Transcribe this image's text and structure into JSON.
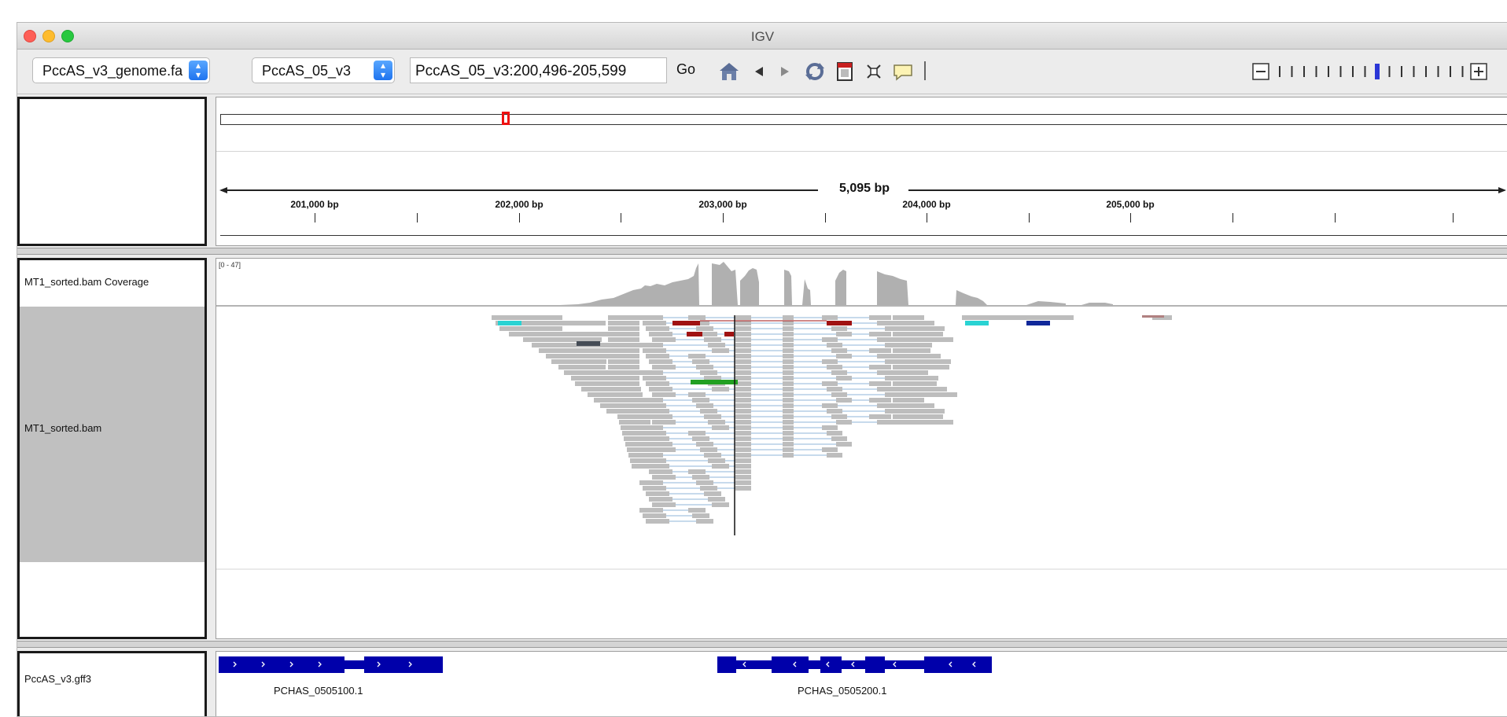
{
  "window": {
    "title": "IGV"
  },
  "toolbar": {
    "genome": "PccAS_v3_genome.fa",
    "chromosome": "PccAS_05_v3",
    "locus": "PccAS_05_v3:200,496-205,599",
    "go_label": "Go",
    "icons": [
      "home-icon",
      "back-arrow-icon",
      "forward-arrow-icon",
      "refresh-icon",
      "region-of-interest-icon",
      "resize-to-window-icon",
      "popup-text-icon"
    ]
  },
  "ruler": {
    "span_label": "5,095 bp",
    "ticks": [
      "201,000 bp",
      "202,000 bp",
      "203,000 bp",
      "204,000 bp",
      "205,000 bp"
    ]
  },
  "tracks": {
    "coverage": {
      "name": "MT1_sorted.bam Coverage",
      "range": "[0 - 47]"
    },
    "alignment": {
      "name": "MT1_sorted.bam"
    },
    "features": {
      "name": "PccAS_v3.gff3",
      "genes": [
        "PCHAS_0505100.1",
        "PCHAS_0505200.1"
      ]
    }
  },
  "colors": {
    "gene": "#0000aa",
    "read": "#bdbdbd",
    "coverage": "#b0b0b0",
    "selected_track": "#c0c0c0",
    "accent": "#2a73ee"
  }
}
